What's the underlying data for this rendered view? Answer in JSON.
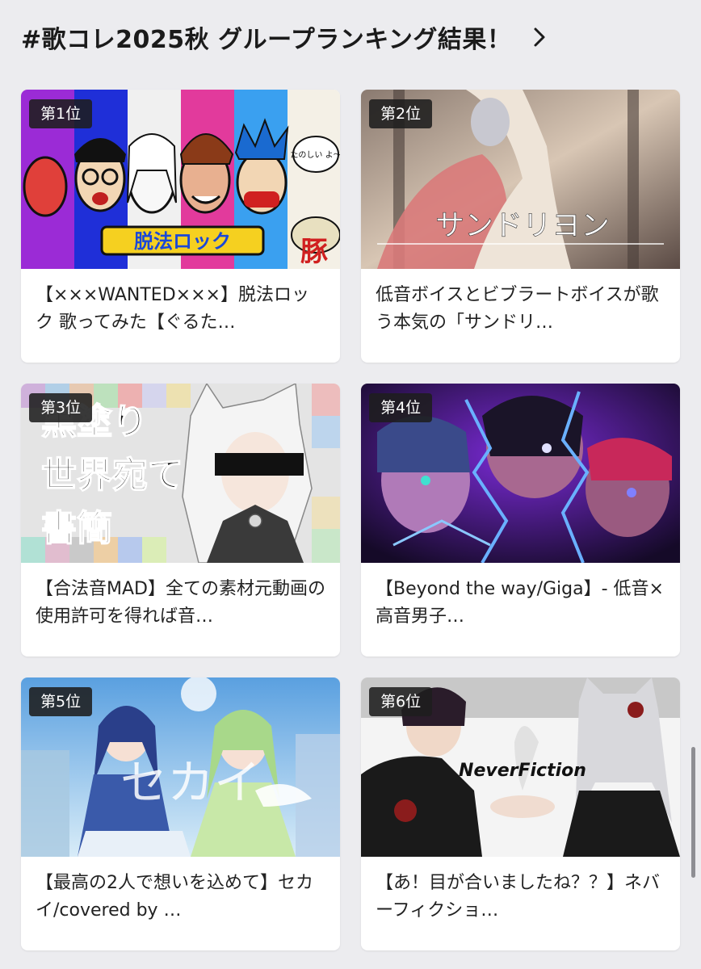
{
  "header": {
    "title": "#歌コレ2025秋 グループランキング結果！",
    "chevron_icon": "chevron-right-icon"
  },
  "cards": [
    {
      "rank": "第1位",
      "title": "【×××WANTED×××】脱法ロック 歌ってみた【ぐるた…",
      "thumb_text": [
        "脱法ロック",
        "豚",
        "たのしい よ〜"
      ],
      "thumb_palette": [
        "#9b2bd6",
        "#1f2fd8",
        "#f0f0f0",
        "#e23a9c",
        "#3aa0f0",
        "#f4f0e6"
      ]
    },
    {
      "rank": "第2位",
      "title": "低音ボイスとビブラートボイスが歌う本気の「サンドリ…",
      "thumb_text": [
        "サンドリヨン"
      ],
      "thumb_palette": [
        "#7a6a62",
        "#d98a8a",
        "#e9d8c8",
        "#3a3030"
      ]
    },
    {
      "rank": "第3位",
      "title": "【合法音MAD】全ての素材元動画の使用許可を得れば音…",
      "thumb_text": [
        "黒塗り",
        "世界宛て",
        "書簡"
      ],
      "thumb_palette": [
        "#d8d8d8",
        "#5a5a5a",
        "#f5f5f5",
        "#111111"
      ]
    },
    {
      "rank": "第4位",
      "title": "【Beyond the way/Giga】- 低音×高音男子…",
      "thumb_text": [],
      "thumb_palette": [
        "#1a1030",
        "#7b2bd8",
        "#4a7ff0",
        "#c8285a"
      ]
    },
    {
      "rank": "第5位",
      "title": "【最高の2人で想いを込めて】セカイ/covered by …",
      "thumb_text": [
        "セカイ"
      ],
      "thumb_palette": [
        "#6ab0e8",
        "#cfe6f7",
        "#2a3f8a",
        "#a8d88a"
      ]
    },
    {
      "rank": "第6位",
      "title": "【あ！目が合いましたね？？】ネバーフィクショ…",
      "thumb_text": [
        "NeverFiction"
      ],
      "thumb_palette": [
        "#f4f4f4",
        "#1a1a1a",
        "#c8c8c8",
        "#8a1c1c"
      ]
    }
  ]
}
